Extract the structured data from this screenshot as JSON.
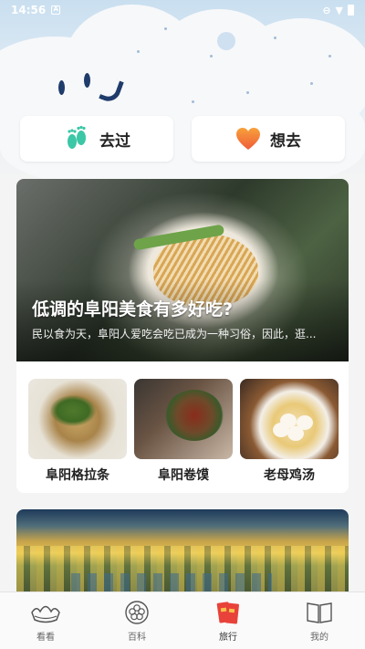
{
  "statusbar": {
    "time": "14:56",
    "sim_icon": "A"
  },
  "toggles": [
    {
      "label": "去过",
      "icon": "footprints-icon"
    },
    {
      "label": "想去",
      "icon": "heart-icon"
    }
  ],
  "food_feature": {
    "title": "低调的阜阳美食有多好吃?",
    "description": "民以食为天，阜阳人爱吃会吃已成为一种习俗，因此，逛..."
  },
  "dishes": [
    {
      "name": "阜阳格拉条"
    },
    {
      "name": "阜阳卷馍"
    },
    {
      "name": "老母鸡汤"
    }
  ],
  "tabbar": {
    "items": [
      {
        "label": "看看",
        "icon": "ingot-icon"
      },
      {
        "label": "百科",
        "icon": "flower-icon"
      },
      {
        "label": "旅行",
        "icon": "ticket-icon"
      },
      {
        "label": "我的",
        "icon": "book-icon"
      }
    ],
    "active": "旅行"
  },
  "colors": {
    "accent": "#e8423a",
    "heart": "#f5932b",
    "feet": "#3cc7a6"
  }
}
